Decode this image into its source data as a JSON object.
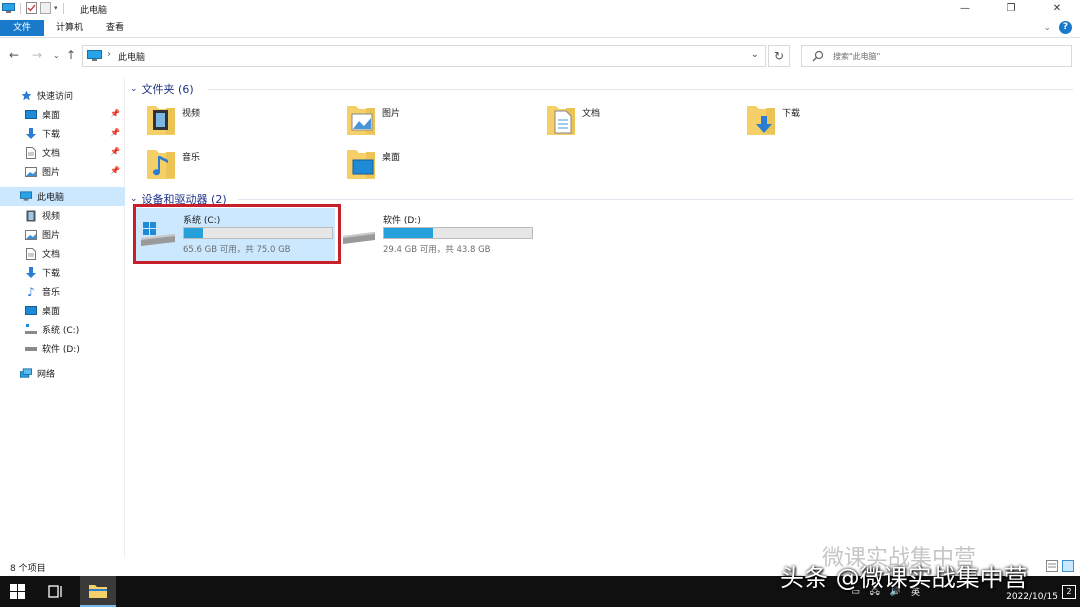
{
  "window": {
    "title": "此电脑",
    "controls": [
      "—",
      "❐",
      "✕"
    ]
  },
  "ribbon": {
    "tabs": [
      "文件",
      "计算机",
      "查看"
    ]
  },
  "address": {
    "path": "此电脑",
    "search_placeholder": "搜索\"此电脑\""
  },
  "nav": {
    "items": [
      {
        "label": "快速访问",
        "icon": "star-icon"
      },
      {
        "label": "桌面",
        "icon": "desktop-icon",
        "pinned": true
      },
      {
        "label": "下载",
        "icon": "download-icon",
        "pinned": true
      },
      {
        "label": "文档",
        "icon": "document-icon",
        "pinned": true
      },
      {
        "label": "图片",
        "icon": "picture-icon",
        "pinned": true
      },
      {
        "label": "此电脑",
        "icon": "pc-icon",
        "selected": true
      },
      {
        "label": "视频",
        "icon": "video-icon"
      },
      {
        "label": "图片",
        "icon": "picture-icon"
      },
      {
        "label": "文档",
        "icon": "document-icon"
      },
      {
        "label": "下载",
        "icon": "download-icon"
      },
      {
        "label": "音乐",
        "icon": "music-icon"
      },
      {
        "label": "桌面",
        "icon": "desktop-icon"
      },
      {
        "label": "系统 (C:)",
        "icon": "system-drive-icon"
      },
      {
        "label": "软件 (D:)",
        "icon": "drive-icon"
      },
      {
        "label": "网络",
        "icon": "network-icon"
      }
    ]
  },
  "folders_group": {
    "header": "文件夹 (6)",
    "items": [
      {
        "label": "视频",
        "icon": "video-folder-icon"
      },
      {
        "label": "图片",
        "icon": "pictures-folder-icon"
      },
      {
        "label": "文档",
        "icon": "documents-folder-icon"
      },
      {
        "label": "下载",
        "icon": "downloads-folder-icon"
      },
      {
        "label": "音乐",
        "icon": "music-folder-icon"
      },
      {
        "label": "桌面",
        "icon": "desktop-folder-icon"
      }
    ]
  },
  "drives_group": {
    "header": "设备和驱动器 (2)",
    "drives": [
      {
        "name": "系统 (C:)",
        "info": "65.6 GB 可用，共 75.0 GB",
        "used_fraction": 0.125,
        "selected": true
      },
      {
        "name": "软件 (D:)",
        "info": "29.4 GB 可用，共 43.8 GB",
        "used_fraction": 0.33,
        "selected": false
      }
    ]
  },
  "status": {
    "count": "8 个项目"
  },
  "taskbar": {
    "tray_lang": "英",
    "date": "2022/10/15",
    "notifications": "2"
  },
  "watermark": {
    "line1": "微课实战集中营",
    "line2": "头条 @微课实战集中营"
  }
}
